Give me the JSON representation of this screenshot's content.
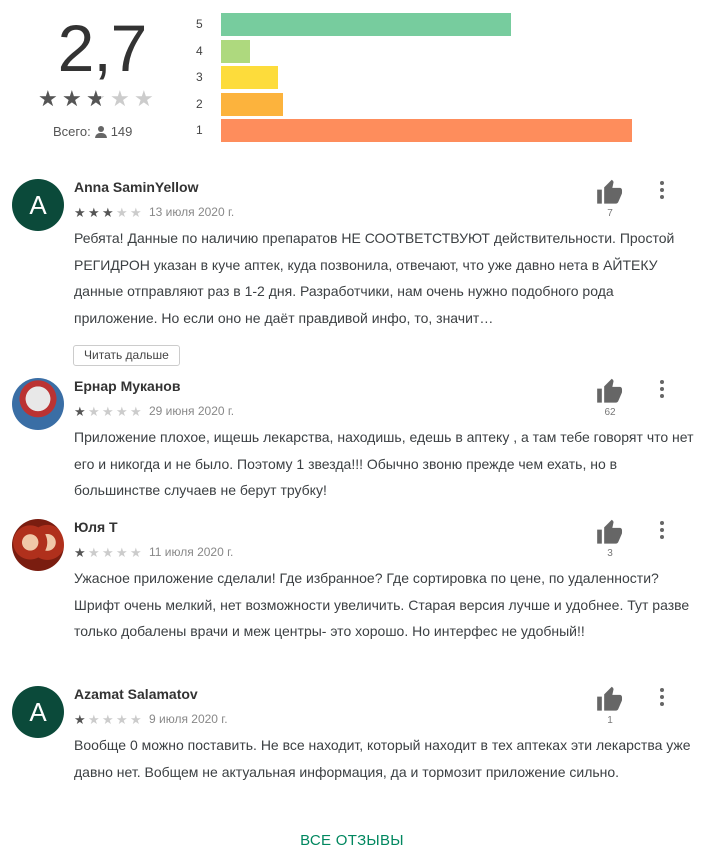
{
  "rating": {
    "score": "2,7",
    "stars": 2.7,
    "total_label": "Всего:",
    "total_count": "149"
  },
  "histogram": [
    {
      "label": "5",
      "fraction": 0.66,
      "color": "#77cc9e"
    },
    {
      "label": "4",
      "fraction": 0.065,
      "color": "#aed97e"
    },
    {
      "label": "3",
      "fraction": 0.13,
      "color": "#fddc3b"
    },
    {
      "label": "2",
      "fraction": 0.14,
      "color": "#fcb33d"
    },
    {
      "label": "1",
      "fraction": 0.935,
      "color": "#fe8d5c"
    }
  ],
  "reviews": [
    {
      "avatar_letter": "A",
      "name": "Anna SaminYellow",
      "stars": 3,
      "date": "13 июля 2020 г.",
      "likes": "7",
      "text": "Ребята! Данные по наличию препаратов НЕ СООТВЕТСТВУЮТ действительности. Простой РЕГИДРОН указан в куче аптек, куда позвонила, отвечают, что уже давно нета в АЙТЕКУ данные отправляют раз в 1-2 дня. Разработчики, нам очень нужно подобного рода приложение. Но если оно не даёт правдивой инфо, то, значит…",
      "read_more": "Читать дальше"
    },
    {
      "avatar_letter": "",
      "name": "Ернар Муканов",
      "stars": 1,
      "date": "29 июня 2020 г.",
      "likes": "62",
      "text": "Приложение плохое, ищешь лекарства, находишь, едешь в аптеку , а там тебе говорят что нет его и никогда и не было. Поэтому 1 звезда!!! Обычно звоню прежде чем ехать, но в большинстве случаев не берут трубку!"
    },
    {
      "avatar_letter": "",
      "name": "Юля Т",
      "stars": 1,
      "date": "11 июля 2020 г.",
      "likes": "3",
      "text": "Ужасное приложение сделали! Где избранное? Где сортировка по цене, по удаленности? Шрифт очень мелкий, нет возможности увеличить. Старая версия лучше и удобнее. Тут разве только добалены врачи и меж центры- это хорошо. Но интерфес не удобный!!"
    },
    {
      "avatar_letter": "A",
      "name": "Azamat Salamatov",
      "stars": 1,
      "date": "9 июля 2020 г.",
      "likes": "1",
      "text": "Вообще 0 можно поставить. Не все находит, который находит в тех аптеках эти лекарства уже давно нет. Вобщем не актуальная информация, да и тормозит приложение сильно."
    }
  ],
  "all_reviews_label": "ВСЕ ОТЗЫВЫ",
  "colors": {
    "accent": "#01875f",
    "avatar_bg": "#0b4a3a",
    "star_filled": "#555555",
    "star_empty": "#cccccc"
  }
}
